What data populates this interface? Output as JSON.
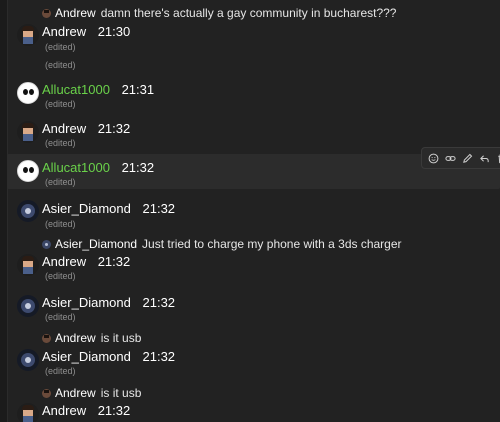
{
  "replies": [
    {
      "user": "Andrew",
      "text": "damn there's actually a gay community in bucharest???"
    },
    {
      "user": "Asier_Diamond",
      "text": "Just tried to charge my phone with a 3ds charger"
    },
    {
      "user": "Andrew",
      "text": "is it usb"
    },
    {
      "user": "Andrew",
      "text": "is it usb"
    }
  ],
  "messages": [
    {
      "user": "Andrew",
      "time": "21:30",
      "edited": "(edited)",
      "extra_edited": "(edited)"
    },
    {
      "user": "Allucat1000",
      "time": "21:31",
      "edited": "(edited)"
    },
    {
      "user": "Andrew",
      "time": "21:32",
      "edited": "(edited)"
    },
    {
      "user": "Allucat1000",
      "time": "21:32",
      "edited": "(edited)"
    },
    {
      "user": "Asier_Diamond",
      "time": "21:32",
      "edited": "(edited)"
    },
    {
      "user": "Andrew",
      "time": "21:32",
      "edited": "(edited)"
    },
    {
      "user": "Asier_Diamond",
      "time": "21:32",
      "edited": "(edited)"
    },
    {
      "user": "Asier_Diamond",
      "time": "21:32",
      "edited": "(edited)"
    },
    {
      "user": "Andrew",
      "time": "21:32"
    }
  ],
  "colors": {
    "background": "#222222",
    "hover_background": "#2c2c2c",
    "username_highlight": "#6ad24a",
    "edited_text": "#8f8f8f"
  },
  "toolbar_icons": [
    "add-reaction-icon",
    "link-icon",
    "edit-icon",
    "reply-icon",
    "delete-icon"
  ]
}
